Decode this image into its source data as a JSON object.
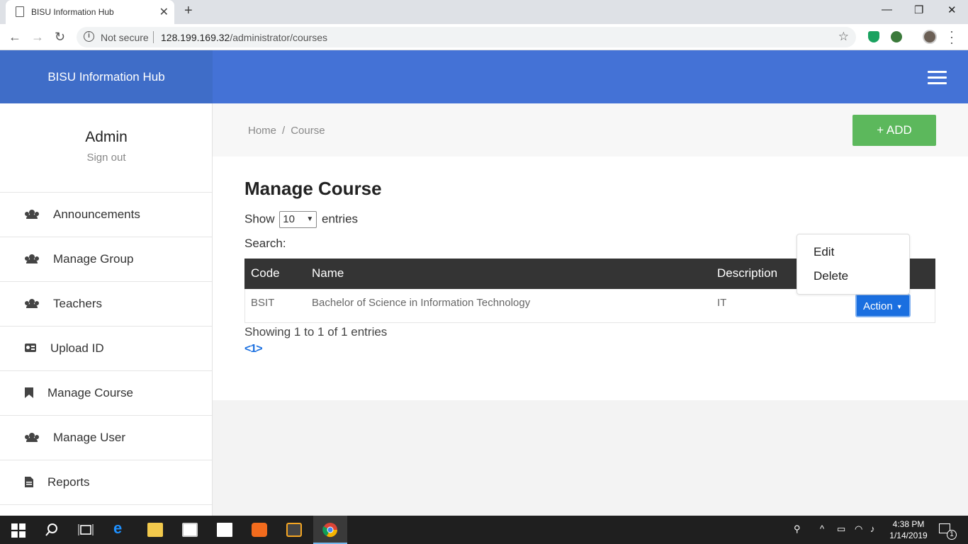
{
  "browser": {
    "tab_title": "BISU Information Hub",
    "tab_close": "✕",
    "new_tab": "+",
    "security": "Not secure",
    "url_host": "128.199.169.32",
    "url_path": "/administrator/courses",
    "minimize": "—",
    "restore": "❐",
    "close": "✕"
  },
  "app": {
    "brand": "BISU Information Hub"
  },
  "sidebar": {
    "user": "Admin",
    "signout": "Sign out",
    "items": [
      {
        "label": "Announcements",
        "icon": "users-icon"
      },
      {
        "label": "Manage Group",
        "icon": "users-icon"
      },
      {
        "label": "Teachers",
        "icon": "users-icon"
      },
      {
        "label": "Upload ID",
        "icon": "id-card-icon"
      },
      {
        "label": "Manage Course",
        "icon": "bookmark-icon"
      },
      {
        "label": "Manage User",
        "icon": "users-icon"
      },
      {
        "label": "Reports",
        "icon": "file-icon"
      }
    ]
  },
  "breadcrumb": {
    "home": "Home",
    "sep": "/",
    "current": "Course"
  },
  "add_button": "+ ADD",
  "main": {
    "title": "Manage Course",
    "show_label": "Show",
    "entries_value": "10",
    "entries_label": "entries",
    "search_label": "Search:",
    "columns": [
      "Code",
      "Name",
      "Description"
    ],
    "rows": [
      {
        "code": "BSIT",
        "name": "Bachelor of Science in Information Technology",
        "description": "IT"
      }
    ],
    "action_label": "Action",
    "dropdown": {
      "edit": "Edit",
      "delete": "Delete"
    },
    "info": "Showing 1 to 1 of 1 entries",
    "pager": {
      "prev": "<",
      "page": "1",
      "next": ">"
    }
  },
  "taskbar": {
    "time": "4:38 PM",
    "date": "1/14/2019",
    "notifications": "1"
  },
  "colors": {
    "brand_bg": "#3f6dc8",
    "topbar_bg": "#4472d6",
    "add_green": "#5cb85c",
    "action_blue": "#1a6fe0",
    "table_header": "#343434"
  }
}
